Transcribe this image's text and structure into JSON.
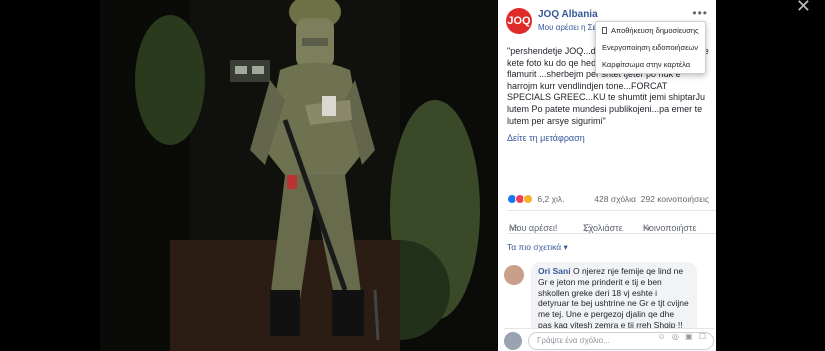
{
  "page": {
    "name": "JOQ Albania",
    "avatar_text": "JOQ",
    "meta": "Μου αρέσει η Σελίδα"
  },
  "menu": {
    "items": [
      "Αποθήκευση δημοσίευσης",
      "Ενεργοποίηση ειδοποιήσεων",
      "Καρφίτσωμα στην καρτέλα"
    ]
  },
  "post": {
    "text": "\"pershendetje JOQ...du greqi turqi te gjith shipt me kete foto ku do qe hedhen ane gezuar festen e flamurit ...sherbejm per shtet tjeter po nuk e harrojm kurr vendlindjen tone...FORCAT SPECIALS GREEC...KU te shumtit jemi shiptarJu lutem Po patete mundesi publikojeni...pa emer te lutem per arsye sigurimi\"",
    "see_translation": "Δείτε τη μετάφραση"
  },
  "stats": {
    "reactions": "6,2 χιλ.",
    "comments": "428 σχόλια",
    "shares": "292 κοινοποιήσεις"
  },
  "actions": {
    "like": "Μου αρέσει!",
    "comment": "Σχολιάστε",
    "share": "Κοινοποιήστε"
  },
  "relevant": "Τα πιο σχετικά ▾",
  "comment": {
    "author": "Ori Sani",
    "text": "O njerez nje femije qe lind ne Gr e jeton me prinderit e tij e ben shkollen greke deri 18 vj eshte i detyruar te bej ushtrine ne Gr e tjt cvijne me tej. Une e pergezoj djalin qe dhe pas kaq vitesh zemra e tij rreh Shqip !!"
  },
  "composer": {
    "placeholder": "Γράψτε ένα σχόλιο...",
    "icons": "☺ ◎ ▣ ☐"
  },
  "colors": {
    "brand": "#365899",
    "avatar": "#e02a2a",
    "like": "#1877f2",
    "love": "#f33e58",
    "haha": "#f7b125"
  },
  "icons": {
    "close": "close-icon",
    "more": "more-icon",
    "like": "like-icon",
    "comment": "comment-icon",
    "share": "share-icon"
  }
}
